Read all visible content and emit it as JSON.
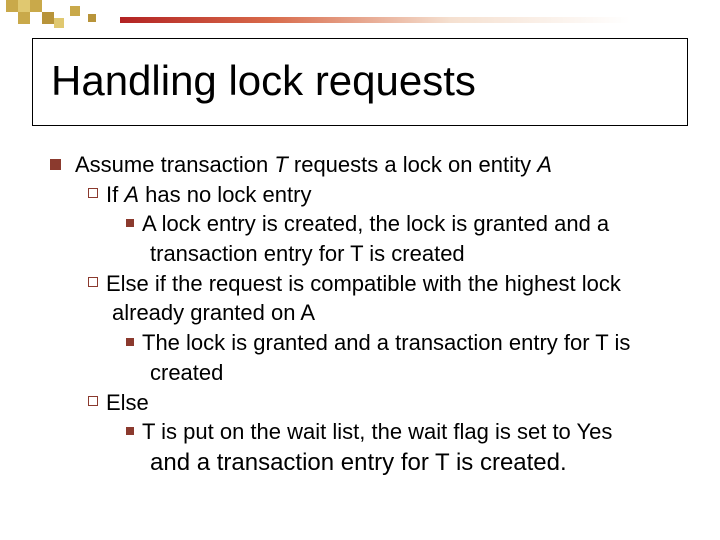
{
  "title": "Handling lock requests",
  "b1_pre": "Assume transaction ",
  "b1_T": "T",
  "b1_mid": " requests a lock on entity ",
  "b1_A": "A",
  "b2_pre": "If ",
  "b2_A": "A",
  "b2_post": " has no lock entry",
  "b3": "A lock entry is created, the lock is granted and a",
  "b3_cont": "transaction entry for T is created",
  "b4": "Else if the request is compatible with the highest lock",
  "b4_cont": "already granted on A",
  "b5": "The lock is granted and a transaction entry for T is",
  "b5_cont": "created",
  "b6": "Else",
  "b7": "T is put on the wait list, the wait flag is set to Yes",
  "b8": "and a transaction entry for T is created."
}
